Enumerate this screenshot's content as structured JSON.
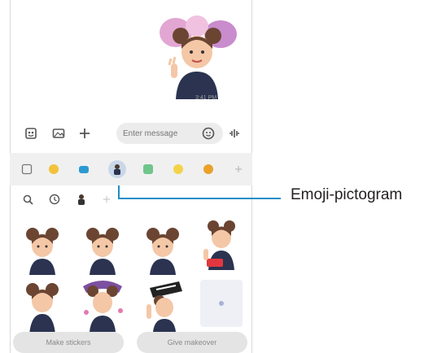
{
  "chat": {
    "timestamp": "3:41 PM"
  },
  "input": {
    "placeholder": "Enter message"
  },
  "bottom": {
    "make_stickers": "Make stickers",
    "give_makeover": "Give makeover"
  },
  "callout": {
    "label": "Emoji-pictogram"
  },
  "colors": {
    "accent": "#1a8fc7",
    "strip_bg": "#f0f0f0",
    "selected_bg": "#c9d8e9"
  },
  "categories": [
    "recent",
    "emoji-face",
    "camera-sticker",
    "ar-emoji-pictogram",
    "gif",
    "star-sticker",
    "bitmoji",
    "more"
  ],
  "subcategories": [
    "search-icon",
    "history-icon",
    "avatar-icon",
    "add-icon"
  ]
}
